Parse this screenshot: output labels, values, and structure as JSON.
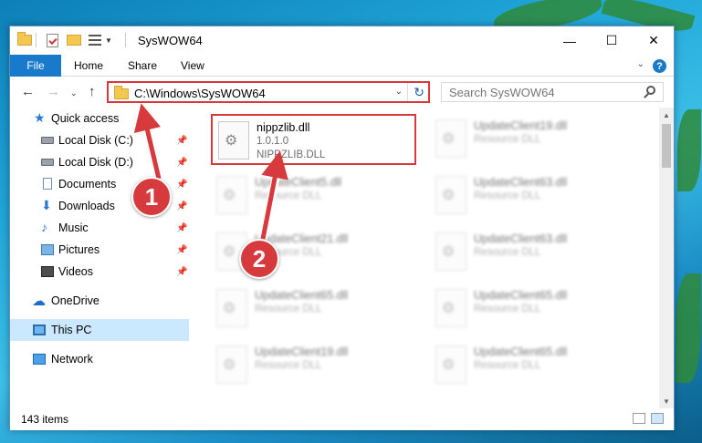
{
  "window": {
    "title": "SysWOW64",
    "controls": {
      "minimize": "—",
      "maximize": "☐",
      "close": "✕"
    }
  },
  "ribbon": {
    "file_tab": "File",
    "tabs": [
      "Home",
      "Share",
      "View"
    ],
    "help": "?"
  },
  "navbar": {
    "address": "C:\\Windows\\SysWOW64",
    "search_placeholder": "Search SysWOW64"
  },
  "navpane": {
    "items": [
      {
        "label": "Quick access",
        "icon": "star-icon",
        "pinned": false
      },
      {
        "label": "Local Disk (C:)",
        "icon": "drive-icon",
        "pinned": true
      },
      {
        "label": "Local Disk (D:)",
        "icon": "drive-icon",
        "pinned": true
      },
      {
        "label": "Documents",
        "icon": "documents-icon",
        "pinned": true
      },
      {
        "label": "Downloads",
        "icon": "downloads-icon",
        "pinned": true
      },
      {
        "label": "Music",
        "icon": "music-icon",
        "pinned": true
      },
      {
        "label": "Pictures",
        "icon": "pictures-icon",
        "pinned": true
      },
      {
        "label": "Videos",
        "icon": "videos-icon",
        "pinned": true
      },
      {
        "label": "OneDrive",
        "icon": "onedrive-icon",
        "pinned": false
      },
      {
        "label": "This PC",
        "icon": "this-pc-icon",
        "pinned": false,
        "selected": true
      },
      {
        "label": "Network",
        "icon": "network-icon",
        "pinned": false
      }
    ]
  },
  "files": [
    {
      "name": "nippzlib.dll",
      "version": "1.0.1.0",
      "description": "NIPPZLIB.DLL",
      "highlighted": true
    },
    {
      "name": "UpdateClient19.dll",
      "description": "Resource DLL"
    },
    {
      "name": "UpdateClient5.dll",
      "description": "Resource DLL"
    },
    {
      "name": "UpdateClient63.dll",
      "description": "Resource DLL"
    },
    {
      "name": "UpdateClient21.dll",
      "description": "Resource DLL"
    },
    {
      "name": "UpdateClient63.dll",
      "description": "Resource DLL"
    },
    {
      "name": "UpdateClient65.dll",
      "description": "Resource DLL"
    },
    {
      "name": "UpdateClient65.dll",
      "description": "Resource DLL"
    },
    {
      "name": "UpdateClient19.dll",
      "description": "Resource DLL"
    },
    {
      "name": "UpdateClient65.dll",
      "description": "Resource DLL"
    }
  ],
  "status": {
    "item_count": "143 items"
  },
  "callouts": [
    "1",
    "2"
  ],
  "colors": {
    "accent": "#1979ca",
    "highlight": "#d9373a",
    "selected": "#cce8ff"
  }
}
